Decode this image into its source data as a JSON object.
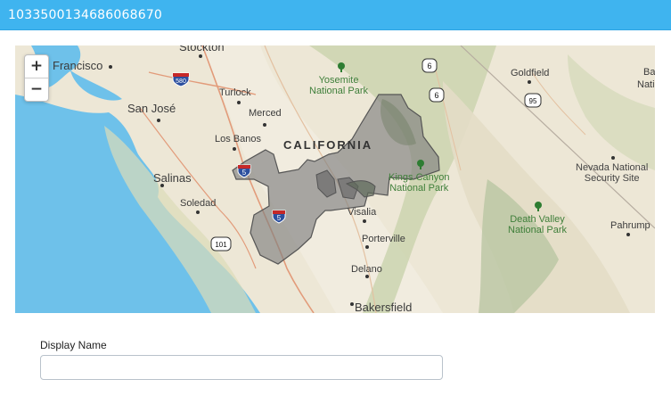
{
  "window": {
    "title": "1033500134686068670"
  },
  "map": {
    "zoom_in_label": "+",
    "zoom_out_label": "−",
    "state_label": "CALIFORNIA",
    "cities": {
      "francisco": "Francisco",
      "stockton": "Stockton",
      "turlock": "Turlock",
      "merced": "Merced",
      "san_jose": "San José",
      "los_banos": "Los Banos",
      "salinas": "Salinas",
      "soledad": "Soledad",
      "visalia": "Visalia",
      "porterville": "Porterville",
      "delano": "Delano",
      "bakersfield": "Bakersfield",
      "goldfield": "Goldfield",
      "pahrump": "Pahrump",
      "ba": "Ba",
      "nati": "Nati"
    },
    "parks": {
      "yosemite_1": "Yosemite",
      "yosemite_2": "National Park",
      "kings_1": "Kings Canyon",
      "kings_2": "National Park",
      "death_1": "Death Valley",
      "death_2": "National Park"
    },
    "security": {
      "line1": "Nevada National",
      "line2": "Security Site"
    },
    "shields": {
      "i580": "580",
      "i5a": "5",
      "i5b": "5",
      "us101": "101",
      "us6a": "6",
      "us6b": "6",
      "us95": "95"
    },
    "colors": {
      "water": "#6ec1ea",
      "land": "#ede7d6",
      "highlight": "#7f7f7f",
      "title_bar": "#3fb4ef"
    }
  },
  "form": {
    "display_name_label": "Display Name",
    "display_name_value": "",
    "display_name_placeholder": ""
  }
}
